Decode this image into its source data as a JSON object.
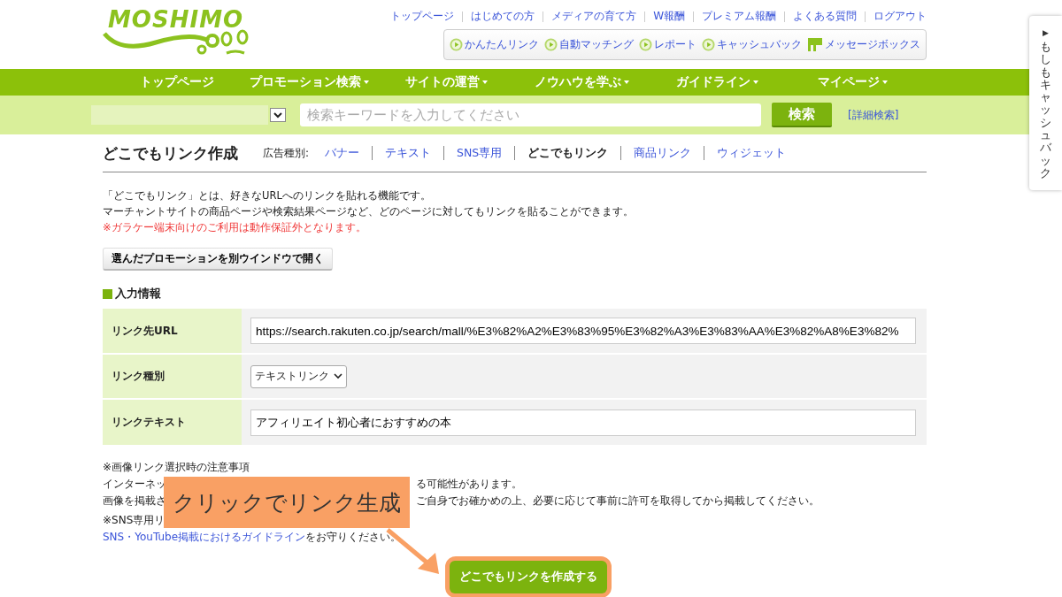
{
  "logo": {
    "text": "MOSHIMO"
  },
  "top_links": [
    "トップページ",
    "はじめての方",
    "メディアの育て方",
    "W報酬",
    "プレミアム報酬",
    "よくある質問",
    "ログアウト"
  ],
  "quick_links": [
    {
      "label": "かんたんリンク",
      "kind": "play"
    },
    {
      "label": "自動マッチング",
      "kind": "play"
    },
    {
      "label": "レポート",
      "kind": "play"
    },
    {
      "label": "キャッシュバック",
      "kind": "play"
    },
    {
      "label": "メッセージボックス",
      "kind": "message"
    }
  ],
  "main_nav": [
    {
      "label": "トップページ",
      "dropdown": false
    },
    {
      "label": "プロモーション検索",
      "dropdown": true
    },
    {
      "label": "サイトの運営",
      "dropdown": true
    },
    {
      "label": "ノウハウを学ぶ",
      "dropdown": true
    },
    {
      "label": "ガイドライン",
      "dropdown": true
    },
    {
      "label": "マイページ",
      "dropdown": true
    }
  ],
  "search": {
    "placeholder": "検索キーワードを入力してください",
    "button": "検索",
    "advanced": "[詳細検索]"
  },
  "side_tab": {
    "arrow": "▶",
    "label": "もしもキャッシュバック"
  },
  "page": {
    "title": "どこでもリンク作成",
    "type_label": "広告種別:",
    "types": [
      {
        "label": "バナー",
        "selected": false
      },
      {
        "label": "テキスト",
        "selected": false
      },
      {
        "label": "SNS専用",
        "selected": false
      },
      {
        "label": "どこでもリンク",
        "selected": true
      },
      {
        "label": "商品リンク",
        "selected": false
      },
      {
        "label": "ウィジェット",
        "selected": false
      }
    ]
  },
  "intro": [
    {
      "text": "「どこでもリンク」とは、好きなURLへのリンクを貼れる機能です。",
      "kind": "normal"
    },
    {
      "text": "マーチャントサイトの商品ページや検索結果ページなど、どのページに対してもリンクを貼ることができます。",
      "kind": "normal"
    },
    {
      "text": "※ガラケー端末向けのご利用は動作保証外となります。",
      "kind": "warning"
    }
  ],
  "open_window_button": "選んだプロモーションを別ウインドウで開く",
  "section_title": "入力情報",
  "form": [
    {
      "label": "リンク先URL",
      "kind": "text",
      "value": "https://search.rakuten.co.jp/search/mall/%E3%82%A2%E3%83%95%E3%82%A3%E3%83%AA%E3%82%A8%E3%82%"
    },
    {
      "label": "リンク種別",
      "kind": "select",
      "value": "テキストリンク"
    },
    {
      "label": "リンクテキスト",
      "kind": "text",
      "value": "アフィリエイト初心者におすすめの本"
    }
  ],
  "notes": [
    {
      "left": "※画像リンク選択時の注意事項"
    },
    {
      "left": "インターネッ",
      "right": "る可能性があります。"
    },
    {
      "left": "画像を掲載さ",
      "right": "ご自身でお確かめの上、必要に応じて事前に許可を取得してから掲載してください。"
    },
    {
      "left": "※SNS専用リ"
    }
  ],
  "guideline": {
    "link": "SNS・YouTube掲載におけるガイドライン",
    "rest": "をお守りください。"
  },
  "submit_button": "どこでもリンクを作成する",
  "callout": "クリックでリンク生成"
}
